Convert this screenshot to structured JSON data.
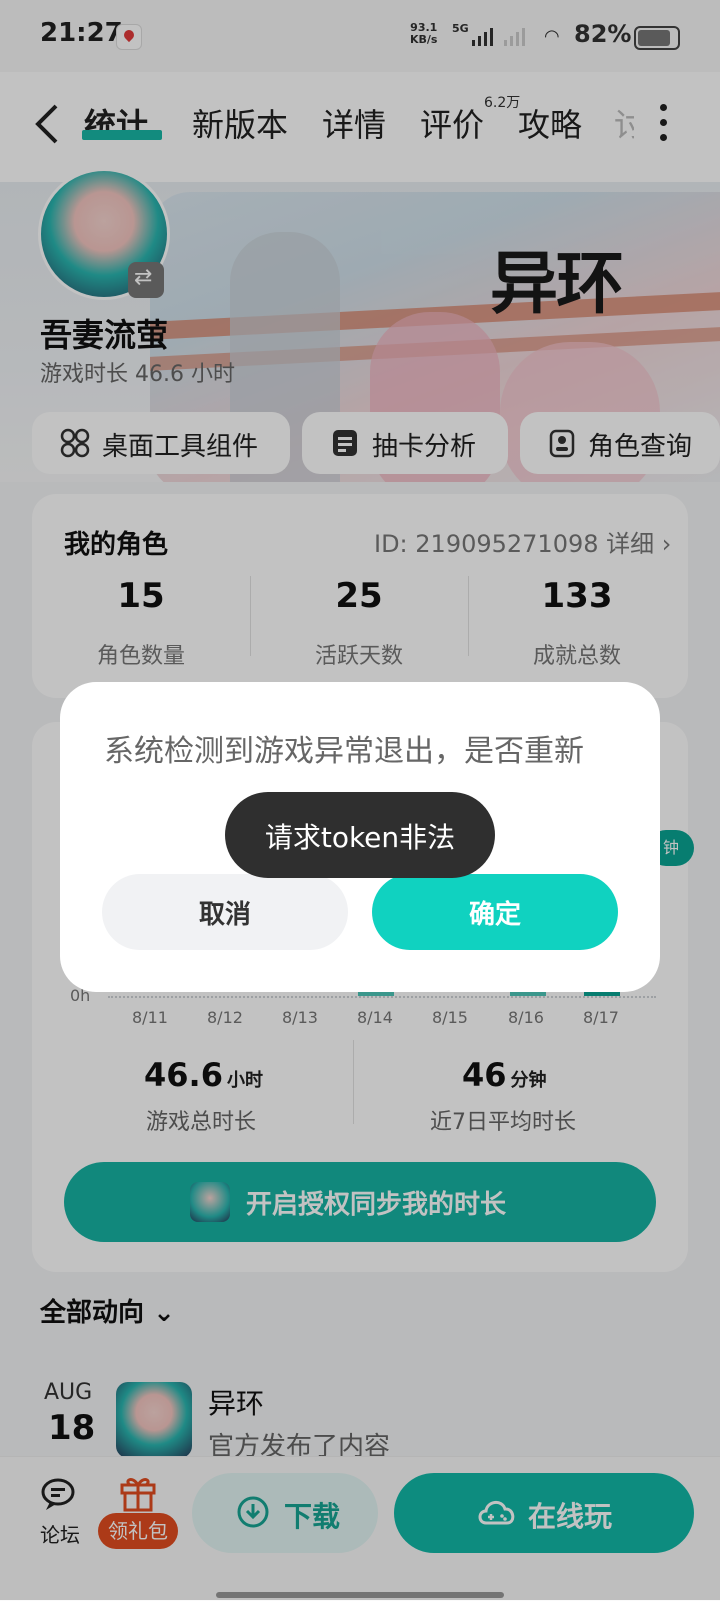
{
  "status": {
    "time": "21:27",
    "speed_top": "93.1",
    "speed_unit": "KB/s",
    "network": "5G",
    "battery": "82%"
  },
  "nav": {
    "tabs": [
      "统计",
      "新版本",
      "详情",
      "评价",
      "攻略",
      "讨"
    ],
    "review_badge": "6.2万"
  },
  "banner": {
    "logo_text": "异环"
  },
  "profile": {
    "name": "吾妻流萤",
    "play_time": "游戏时长 46.6 小时"
  },
  "tools": [
    {
      "label": "桌面工具组件",
      "icon": "widgets-icon"
    },
    {
      "label": "抽卡分析",
      "icon": "document-icon"
    },
    {
      "label": "角色查询",
      "icon": "id-card-icon"
    }
  ],
  "roles": {
    "title": "我的角色",
    "id_text": "ID: 219095271098 详细",
    "stats": [
      {
        "value": "15",
        "label": "角色数量"
      },
      {
        "value": "25",
        "label": "活跃天数"
      },
      {
        "value": "133",
        "label": "成就总数"
      }
    ]
  },
  "chart": {
    "zero_label": "0h",
    "minute_pill": "钟",
    "dates": [
      "8/11",
      "8/12",
      "8/13",
      "8/14",
      "8/15",
      "8/16",
      "8/17"
    ],
    "summary": [
      {
        "value": "46.6",
        "unit": "小时",
        "label": "游戏总时长"
      },
      {
        "value": "46",
        "unit": "分钟",
        "label": "近7日平均时长"
      }
    ],
    "auth_button": "开启授权同步我的时长"
  },
  "feed": {
    "header": "全部动向",
    "month": "AUG",
    "day": "18",
    "name": "异环",
    "subtitle": "官方发布了内容"
  },
  "bottom": {
    "forum": "论坛",
    "gift": "领礼包",
    "download": "下载",
    "play_online": "在线玩"
  },
  "dialog": {
    "message": "系统检测到游戏异常退出，是否重新",
    "cancel": "取消",
    "confirm": "确定"
  },
  "toast": {
    "text": "请求token非法"
  },
  "colors": {
    "accent": "#17b3a3",
    "confirm": "#10d2c0",
    "gift_badge": "#e24d20"
  }
}
